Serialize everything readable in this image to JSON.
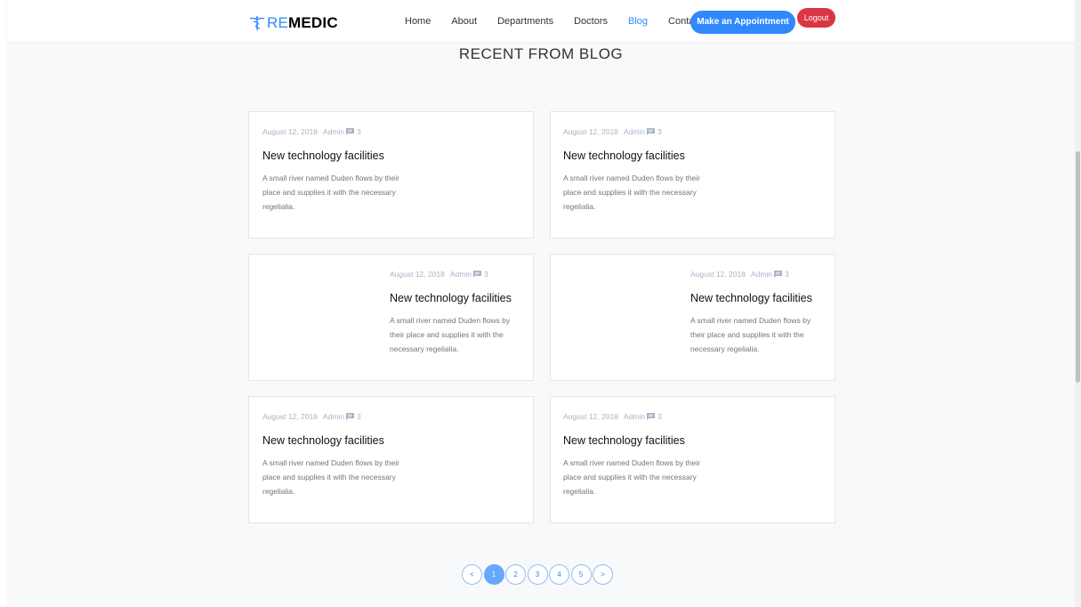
{
  "brand": {
    "re": "RE",
    "medic": "MEDIC"
  },
  "nav": {
    "items": [
      {
        "label": "Home"
      },
      {
        "label": "About"
      },
      {
        "label": "Departments"
      },
      {
        "label": "Doctors"
      },
      {
        "label": "Blog",
        "active": true
      },
      {
        "label": "Contact"
      }
    ],
    "appointment_label": "Make an Appointment",
    "logout_label": "Logout"
  },
  "section": {
    "title": "RECENT FROM BLOG"
  },
  "posts": [
    {
      "date": "August 12, 2018",
      "author": "Admin",
      "comments": "3",
      "title": "New technology facilities",
      "excerpt": "A small river named Duden flows by their place and supplies it with the necessary regelialia."
    },
    {
      "date": "August 12, 2018",
      "author": "Admin",
      "comments": "3",
      "title": "New technology facilities",
      "excerpt": "A small river named Duden flows by their place and supplies it with the necessary regelialia."
    },
    {
      "date": "August 12, 2018",
      "author": "Admin",
      "comments": "3",
      "title": "New technology facilities",
      "excerpt": "A small river named Duden flows by their place and supplies it with the necessary regelialia."
    },
    {
      "date": "August 12, 2018",
      "author": "Admin",
      "comments": "3",
      "title": "New technology facilities",
      "excerpt": "A small river named Duden flows by their place and supplies it with the necessary regelialia."
    },
    {
      "date": "August 12, 2018",
      "author": "Admin",
      "comments": "3",
      "title": "New technology facilities",
      "excerpt": "A small river named Duden flows by their place and supplies it with the necessary regelialia."
    },
    {
      "date": "August 12, 2018",
      "author": "Admin",
      "comments": "3",
      "title": "New technology facilities",
      "excerpt": "A small river named Duden flows by their place and supplies it with the necessary regelialia."
    }
  ],
  "pagination": {
    "prev": "<",
    "pages": [
      "1",
      "2",
      "3",
      "4",
      "5"
    ],
    "next": ">",
    "current": "1"
  },
  "colors": {
    "accent": "#2f89fc",
    "logout": "#dc3545",
    "background": "#f8f9fa"
  },
  "icons": {
    "logo": "caduceus-icon",
    "comment": "comment-icon"
  }
}
